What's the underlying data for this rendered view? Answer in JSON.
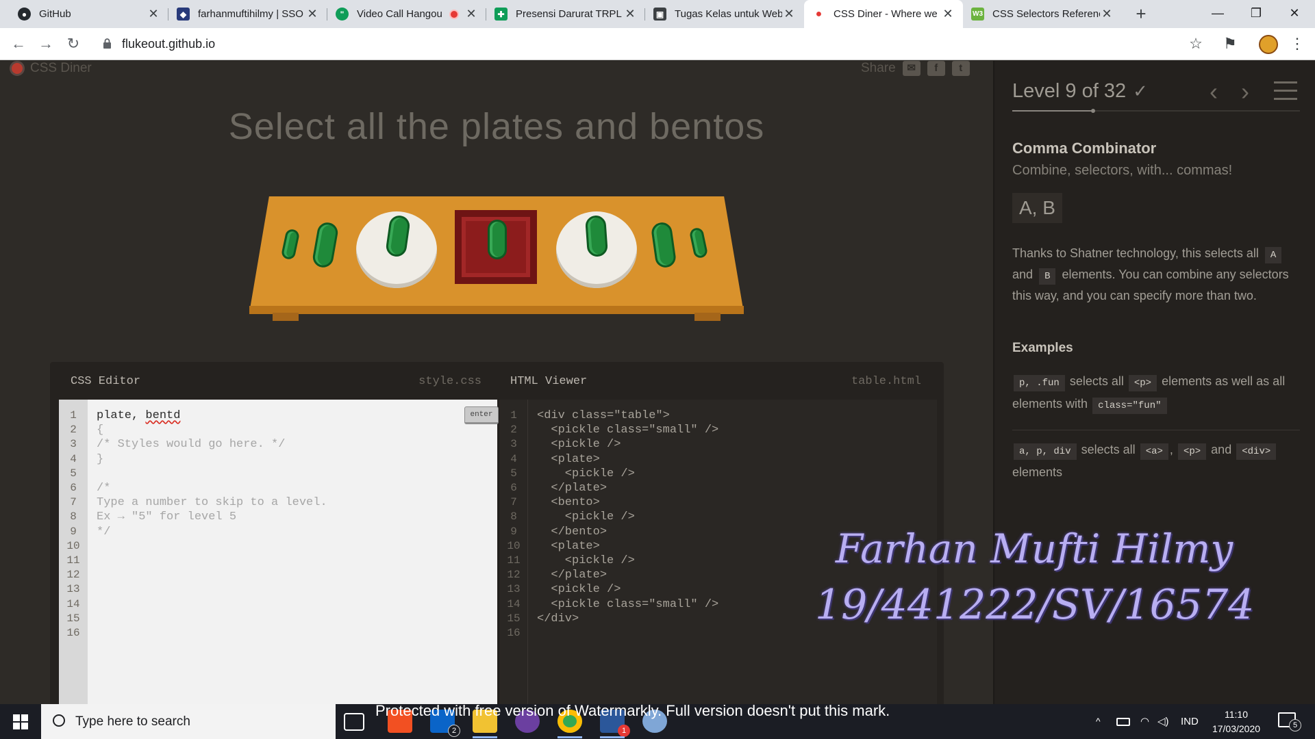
{
  "browser": {
    "tabs": [
      {
        "title": "GitHub",
        "favicon_color": "#24292e",
        "favicon_glyph": "◉"
      },
      {
        "title": "farhanmuftihilmy | SSO",
        "favicon_color": "#283a7a",
        "favicon_glyph": "◆"
      },
      {
        "title": "Video Call Hangou",
        "favicon_color": "#0f9d58",
        "favicon_glyph": "●"
      },
      {
        "title": "Presensi Darurat TRPL",
        "favicon_color": "#0f9d58",
        "favicon_glyph": "✚"
      },
      {
        "title": "Tugas Kelas untuk Web",
        "favicon_color": "#3c4043",
        "favicon_glyph": "▣"
      },
      {
        "title": "CSS Diner - Where we",
        "favicon_color": "#e53935",
        "favicon_glyph": "●",
        "active": true
      },
      {
        "title": "CSS Selectors Referenc",
        "favicon_color": "#6cb33f",
        "favicon_glyph": "W3"
      }
    ],
    "tab_close": "✕",
    "new_tab": "+",
    "window_controls": {
      "minimize": "—",
      "maximize": "❐",
      "close": "✕"
    },
    "url": "flukeout.github.io",
    "nav": {
      "back": "←",
      "forward": "→",
      "reload": "↻"
    },
    "toolbar_right": {
      "star": "☆",
      "bookmark_icon": "⚑",
      "menu": "⋮"
    }
  },
  "site": {
    "logo": "CSS Diner",
    "share_label": "Share",
    "instruction": "Select all the plates and bentos"
  },
  "editor": {
    "css_title": "CSS Editor",
    "css_file": "style.css",
    "html_title": "HTML Viewer",
    "html_file": "table.html",
    "enter_label": "enter",
    "css_input_prefix": "plate, ",
    "css_input_misspelled": "bentd",
    "css_lines": [
      "{",
      "/* Styles would go here. */",
      "}",
      "",
      "/*",
      "Type a number to skip to a level.",
      "Ex → \"5\" for level 5",
      "*/"
    ],
    "line_numbers": [
      "1",
      "2",
      "3",
      "4",
      "5",
      "6",
      "7",
      "8",
      "9",
      "10",
      "11",
      "12",
      "13",
      "14",
      "15",
      "16"
    ],
    "html_lines": [
      "<div class=\"table\">",
      "  <pickle class=\"small\" />",
      "  <pickle />",
      "  <plate>",
      "    <pickle />",
      "  </plate>",
      "  <bento>",
      "    <pickle />",
      "  </bento>",
      "  <plate>",
      "    <pickle />",
      "  </plate>",
      "  <pickle />",
      "  <pickle class=\"small\" />",
      "</div>",
      ""
    ]
  },
  "sidebar": {
    "level_label": "Level 9 of 32",
    "level_current": 9,
    "level_total": 32,
    "check": "✓",
    "prev": "‹",
    "next": "›",
    "title": "Comma Combinator",
    "subtitle": "Combine, selectors, with... commas!",
    "syntax": "A, B",
    "desc_1": "Thanks to Shatner technology, this selects all",
    "desc_tag_a": "A",
    "desc_2": "and",
    "desc_tag_b": "B",
    "desc_3": "elements. You can combine any selectors this way, and you can specify more than two.",
    "examples_title": "Examples",
    "ex1_code": "p, .fun",
    "ex1_text1": "selects all",
    "ex1_tag1": "<p>",
    "ex1_text2": "elements as well as all elements with",
    "ex1_tag2": "class=\"fun\"",
    "ex2_code": "a, p, div",
    "ex2_text1": "selects all",
    "ex2_tag1": "<a>",
    "ex2_sep": ",",
    "ex2_tag2": "<p>",
    "ex2_text2": "and",
    "ex2_tag3": "<div>",
    "ex2_text3": "elements"
  },
  "overlay": {
    "signature_name": "Farhan Mufti Hilmy",
    "signature_id": "19/441222/SV/16574",
    "watermark": "Protected with free version of Watermarkly. Full version doesn't put this mark."
  },
  "taskbar": {
    "search_placeholder": "Type here to search",
    "mail_badge": "2",
    "app_badge": "1",
    "language": "IND",
    "time": "11:10",
    "date": "17/03/2020",
    "notification_count": "5",
    "tray_caret": "^",
    "colors": {
      "accent": "#8fb4f0"
    }
  }
}
